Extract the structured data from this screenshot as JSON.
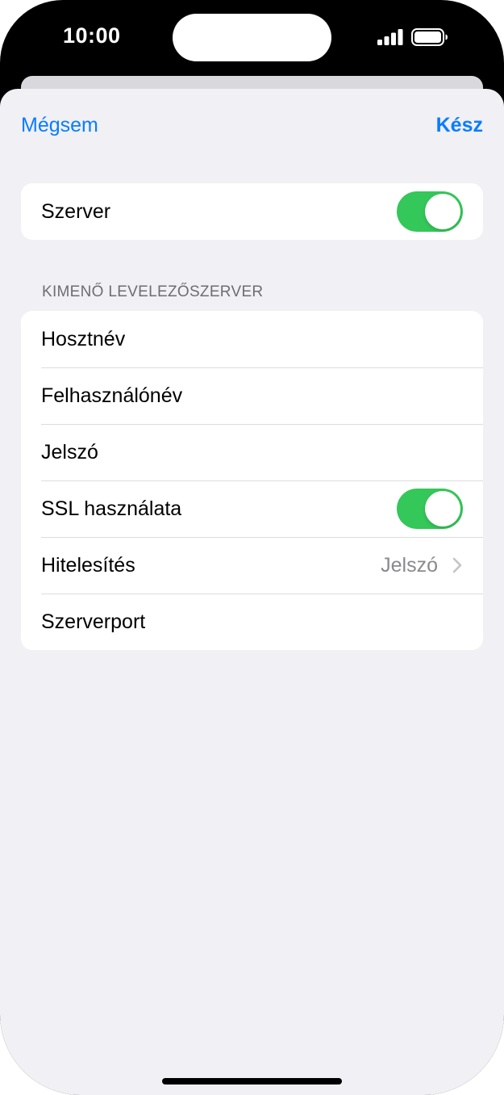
{
  "status_bar": {
    "time": "10:00",
    "icons": [
      "cellular-signal-icon",
      "battery-icon"
    ]
  },
  "nav": {
    "cancel_label": "Mégsem",
    "done_label": "Kész",
    "accent_color": "#0a7cff"
  },
  "server_group": {
    "rows": [
      {
        "label": "Szerver",
        "toggle_on": true
      }
    ]
  },
  "outgoing_section": {
    "header": "KIMENŐ LEVELEZŐSZERVER",
    "rows": [
      {
        "label": "Hosztnév"
      },
      {
        "label": "Felhasználónév"
      },
      {
        "label": "Jelszó"
      },
      {
        "label": "SSL használata",
        "toggle_on": true
      },
      {
        "label": "Hitelesítés",
        "value": "Jelszó",
        "icon": "chevron-right-icon"
      },
      {
        "label": "Szerverport"
      }
    ]
  },
  "colors": {
    "toggle_on": "#34c759",
    "background": "#f0f0f5"
  }
}
